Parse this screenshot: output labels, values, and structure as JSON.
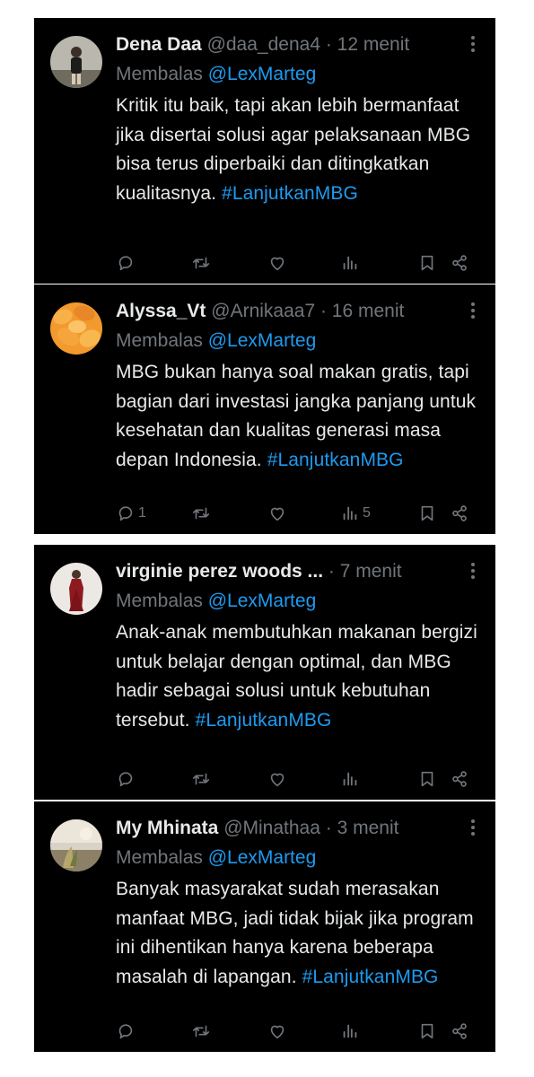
{
  "tweets": [
    {
      "name": "Dena Daa",
      "handle": "@daa_dena4",
      "time": "· 12 menit",
      "reply_prefix": "Membalas",
      "reply_to": "@LexMarteg",
      "text": "Kritik itu baik, tapi akan lebih bermanfaat jika disertai solusi agar pelaksanaan MBG bisa terus diperbaiki dan ditingkatkan kualitasnya.",
      "hashtag": "#LanjutkanMBG",
      "replies": "",
      "views": ""
    },
    {
      "name": "Alyssa_Vt",
      "handle": "@Arnikaaa7",
      "time": "· 16 menit",
      "reply_prefix": "Membalas",
      "reply_to": "@LexMarteg",
      "text": "MBG bukan hanya soal makan gratis, tapi bagian dari investasi jangka panjang untuk kesehatan dan kualitas generasi masa depan Indonesia.",
      "hashtag": "#LanjutkanMBG",
      "replies": "1",
      "views": "5"
    },
    {
      "name": "virginie perez woods ...",
      "handle": "",
      "time": "· 7 menit",
      "reply_prefix": "Membalas",
      "reply_to": "@LexMarteg",
      "text": "Anak-anak membutuhkan makanan bergizi untuk belajar dengan optimal, dan MBG hadir sebagai solusi untuk kebutuhan tersebut.",
      "hashtag": "#LanjutkanMBG",
      "replies": "",
      "views": ""
    },
    {
      "name": "My Mhinata",
      "handle": "@Minathaa",
      "time": "· 3 menit",
      "reply_prefix": "Membalas",
      "reply_to": "@LexMarteg",
      "text": "Banyak masyarakat sudah merasakan manfaat MBG, jadi tidak bijak jika program ini dihentikan hanya karena beberapa masalah di lapangan.",
      "hashtag": "#LanjutkanMBG",
      "replies": "",
      "views": ""
    }
  ],
  "colors": {
    "background": "#000000",
    "text": "#e7e9ea",
    "muted": "#71767b",
    "link": "#1d9bf0"
  },
  "icons": [
    "reply-icon",
    "retweet-icon",
    "like-icon",
    "views-icon",
    "bookmark-icon",
    "share-icon",
    "more-icon"
  ]
}
